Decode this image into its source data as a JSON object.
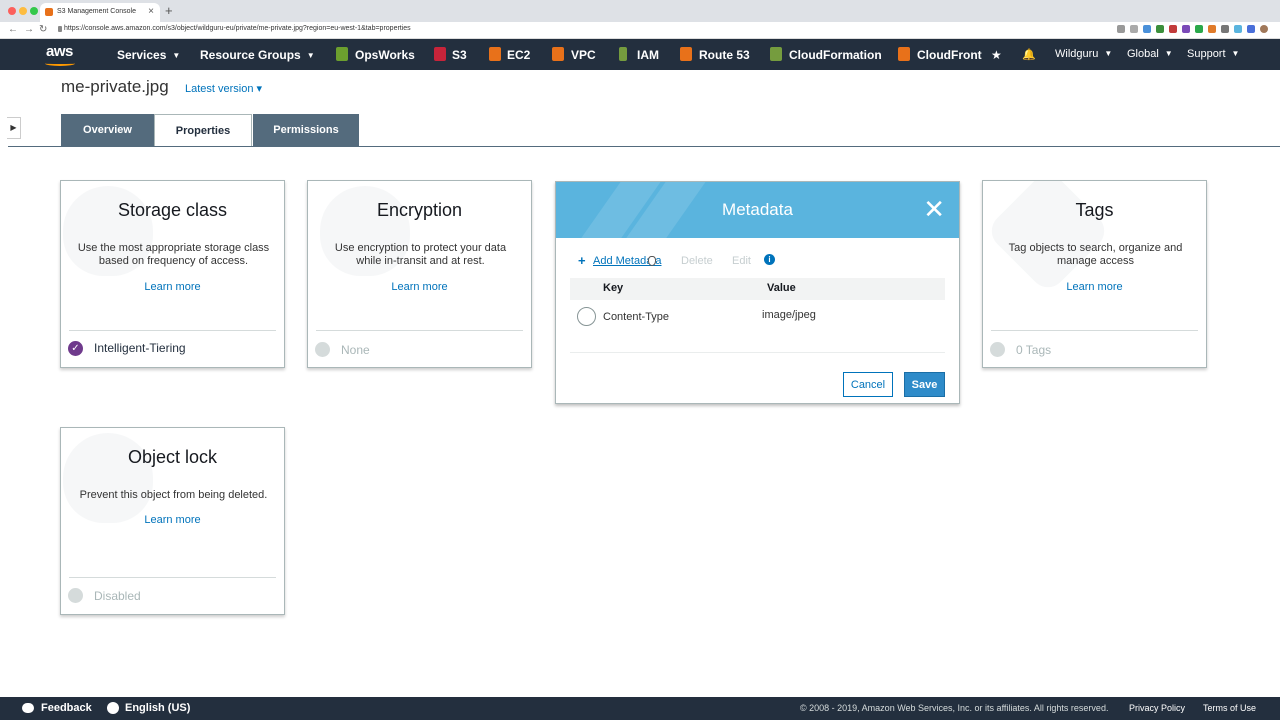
{
  "browser": {
    "tab_title": "S3 Management Console",
    "new_tab": "+",
    "close": "×",
    "url": "https://console.aws.amazon.com/s3/object/wildguru-eu/private/me-private.jpg?region=eu-west-1&tab=properties"
  },
  "nav": {
    "logo": "aws",
    "services": "Services",
    "resource_groups": "Resource Groups",
    "opsworks": "OpsWorks",
    "s3": "S3",
    "ec2": "EC2",
    "vpc": "VPC",
    "iam": "IAM",
    "route53": "Route 53",
    "cloudformation": "CloudFormation",
    "cloudfront": "CloudFront",
    "user": "Wildguru",
    "region": "Global",
    "support": "Support",
    "caret": "▼",
    "pin": "★",
    "bell": "🔔"
  },
  "header": {
    "object_name": "me-private.jpg",
    "version": "Latest version ▾",
    "side_toggle": "▶"
  },
  "tabs": [
    {
      "label": "Overview"
    },
    {
      "label": "Properties"
    },
    {
      "label": "Permissions"
    }
  ],
  "cards": {
    "storage": {
      "title": "Storage class",
      "desc": "Use the most appropriate storage class based on frequency of access.",
      "link": "Learn more",
      "status": "Intelligent-Tiering",
      "check": "✓"
    },
    "encryption": {
      "title": "Encryption",
      "desc": "Use encryption to protect your data while in-transit and at rest.",
      "link": "Learn more",
      "status": "None"
    },
    "tags": {
      "title": "Tags",
      "desc": "Tag objects to search, organize and manage access",
      "link": "Learn more",
      "status": "0 Tags"
    },
    "objectlock": {
      "title": "Object lock",
      "desc": "Prevent this object from being deleted.",
      "link": "Learn more",
      "status": "Disabled"
    }
  },
  "metadata": {
    "title": "Metadata",
    "close": "✕",
    "plus": "+",
    "add": "Add Metadata",
    "delete": "Delete",
    "edit": "Edit",
    "info": "i",
    "col_key": "Key",
    "col_value": "Value",
    "rows": [
      {
        "key": "Content-Type",
        "value": "image/jpeg"
      }
    ],
    "cancel": "Cancel",
    "save": "Save"
  },
  "footer": {
    "feedback": "Feedback",
    "language": "English (US)",
    "copyright": "© 2008 - 2019, Amazon Web Services, Inc. or its affiliates. All rights reserved.",
    "privacy": "Privacy Policy",
    "terms": "Terms of Use"
  },
  "colors": {
    "nav_bg": "#232f3e",
    "link": "#0073bb",
    "tab_inactive": "#546b7d",
    "metadata_header": "#5ab4de",
    "check_purple": "#6f3a8c"
  }
}
